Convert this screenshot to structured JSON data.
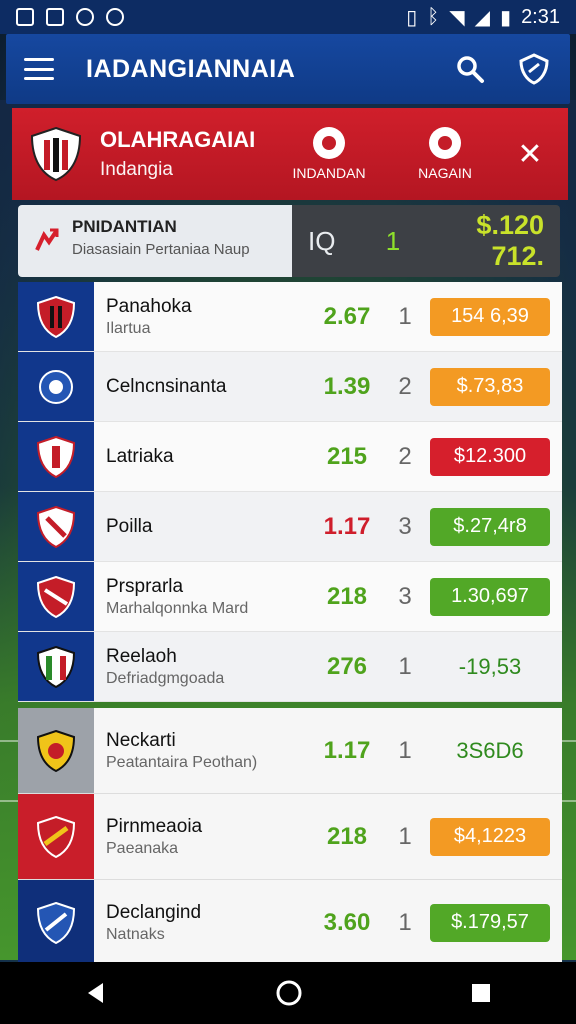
{
  "status_bar": {
    "time": "2:31"
  },
  "app_bar": {
    "title": "IADANGIANNAIA"
  },
  "match_header": {
    "title": "OLAHRAGAIAI",
    "subtitle": "Indangia",
    "tab_left": "INDANDAN",
    "tab_right": "NAGAIN"
  },
  "summary": {
    "title": "PNIDANTIAN",
    "subtitle": "Diasasiain Pertaniaa Naup",
    "count": "1",
    "amount": "$.120 712."
  },
  "colors": {
    "brand_blue": "#1648a0",
    "accent_red": "#d01f2b",
    "odds_green": "#4fa31c",
    "pill_orange": "#f39a23"
  },
  "rows": [
    {
      "team": "Panahoka",
      "sub": "Ilartua",
      "odds": "2.67",
      "pos": "1",
      "value": "154 6,39"
    },
    {
      "team": "Celncnsinanta",
      "sub": "",
      "odds": "1.39",
      "pos": "2",
      "value": "$.73,83"
    },
    {
      "team": "Latriaka",
      "sub": "",
      "odds": "215",
      "pos": "2",
      "value": "$12.300"
    },
    {
      "team": "Poilla",
      "sub": "",
      "odds": "1.17",
      "pos": "3",
      "value": "$.27,4r8"
    },
    {
      "team": "Prsprarla",
      "sub": "Marhalqonnka Mard",
      "odds": "218",
      "pos": "3",
      "value": "1.30,697"
    },
    {
      "team": "Reelaoh",
      "sub": "Defriadgmgoada",
      "odds": "276",
      "pos": "1",
      "value": "-19,53"
    }
  ],
  "rows2": [
    {
      "team": "Neckarti",
      "sub": "Peatantaira Peothan)",
      "odds": "1.17",
      "pos": "1",
      "value": "3S6D6"
    },
    {
      "team": "Pirnmeaoia",
      "sub": "Paeanaka",
      "odds": "218",
      "pos": "1",
      "value": "$4,1223"
    },
    {
      "team": "Declangind",
      "sub": "Natnaks",
      "odds": "3.60",
      "pos": "1",
      "value": "$.179,57"
    }
  ]
}
